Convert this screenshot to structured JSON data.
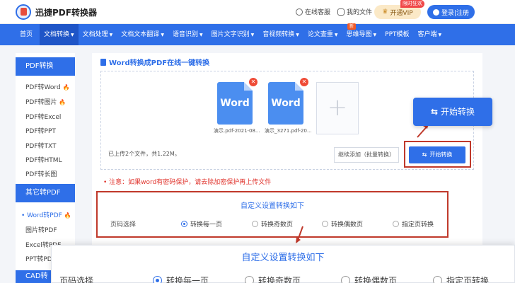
{
  "header": {
    "brand": "迅捷PDF转换器",
    "service_label": "在线客服",
    "my_files_label": "我的文件",
    "vip_label": "开通VIP",
    "vip_tag": "限时狂欢",
    "login_label": "登录|注册"
  },
  "nav": {
    "items": [
      {
        "label": "首页",
        "dropdown": false
      },
      {
        "label": "文档转换",
        "dropdown": true
      },
      {
        "label": "文档处理",
        "dropdown": true
      },
      {
        "label": "文档文本翻译",
        "dropdown": true
      },
      {
        "label": "语音识别",
        "dropdown": true
      },
      {
        "label": "图片文字识别",
        "dropdown": true
      },
      {
        "label": "音视频转换",
        "dropdown": true
      },
      {
        "label": "论文查重",
        "dropdown": true
      },
      {
        "label": "思维导图",
        "dropdown": true
      },
      {
        "label": "PPT模板",
        "dropdown": false
      },
      {
        "label": "客户端",
        "dropdown": true
      }
    ],
    "new_badge": "新"
  },
  "sidebar": {
    "section1_title": "PDF转换",
    "section1_items": [
      "PDF转Word",
      "PDF转图片",
      "PDF转Excel",
      "PDF转PPT",
      "PDF转TXT",
      "PDF转HTML",
      "PDF转长图"
    ],
    "section2_title": "其它转PDF",
    "section2_items": [
      "Word转PDF",
      "图片转PDF",
      "Excel转PDF",
      "PPT转PDF"
    ],
    "section3_title": "CAD转"
  },
  "main": {
    "title": "Word转换成PDF在线一键转换",
    "files": [
      {
        "thumb_text": "Word",
        "name": "演示.pdf-2021-08..."
      },
      {
        "thumb_text": "Word",
        "name": "演示_3271.pdf-20..."
      }
    ],
    "upload_info": "已上传2个文件，共1.22M。",
    "continue_label": "继续添加（批量转换）",
    "start_label": "开始转换",
    "notice": "注意：如果word有密码保护，请去除加密保护再上传文件",
    "settings_title": "自定义设置转换如下",
    "page_select_label": "页码选择",
    "options": [
      "转换每一页",
      "转换奇数页",
      "转换偶数页",
      "指定页转换"
    ],
    "selected_option": 0
  },
  "zoom": {
    "title": "自定义设置转换如下",
    "page_select_label": "页码选择",
    "options": [
      "转换每一页",
      "转换奇数页",
      "转换偶数页",
      "指定页转换"
    ]
  },
  "colors": {
    "brand_blue": "#2f6fe8",
    "highlight_red": "#c0392b",
    "notice_red": "#e0322b"
  }
}
